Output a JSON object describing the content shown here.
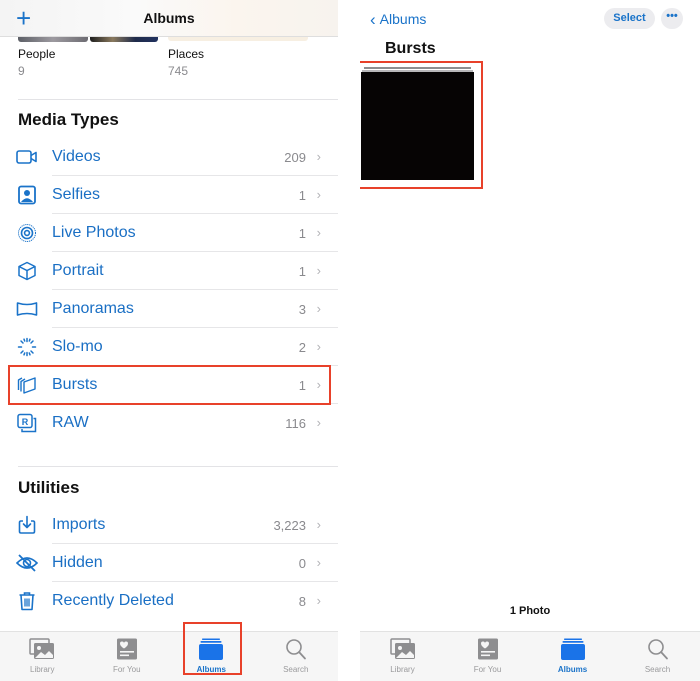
{
  "left": {
    "nav": {
      "title": "Albums",
      "add_icon": "plus-icon"
    },
    "people": {
      "name": "People",
      "count": "9"
    },
    "places": {
      "name": "Places",
      "count": "745"
    },
    "media_types": {
      "title": "Media Types",
      "items": [
        {
          "label": "Videos",
          "count": "209",
          "icon": "video-icon"
        },
        {
          "label": "Selfies",
          "count": "1",
          "icon": "selfie-icon"
        },
        {
          "label": "Live Photos",
          "count": "1",
          "icon": "live-photo-icon"
        },
        {
          "label": "Portrait",
          "count": "1",
          "icon": "cube-icon"
        },
        {
          "label": "Panoramas",
          "count": "3",
          "icon": "panorama-icon"
        },
        {
          "label": "Slo-mo",
          "count": "2",
          "icon": "slomo-icon"
        },
        {
          "label": "Bursts",
          "count": "1",
          "icon": "bursts-icon",
          "highlighted": true
        },
        {
          "label": "RAW",
          "count": "116",
          "icon": "raw-icon"
        }
      ]
    },
    "utilities": {
      "title": "Utilities",
      "items": [
        {
          "label": "Imports",
          "count": "3,223",
          "icon": "import-icon"
        },
        {
          "label": "Hidden",
          "count": "0",
          "icon": "eye-slash-icon"
        },
        {
          "label": "Recently Deleted",
          "count": "8",
          "icon": "trash-icon"
        }
      ]
    },
    "tabbar": {
      "active": "Albums",
      "tabs": [
        {
          "label": "Library",
          "icon": "library-icon"
        },
        {
          "label": "For You",
          "icon": "for-you-icon"
        },
        {
          "label": "Albums",
          "icon": "albums-icon"
        },
        {
          "label": "Search",
          "icon": "search-icon"
        }
      ]
    }
  },
  "right": {
    "nav": {
      "back_label": "Albums",
      "select_label": "Select",
      "more_label": "•••"
    },
    "album_title": "Bursts",
    "photo_count": "1 Photo",
    "tabbar": {
      "active": "Albums",
      "tabs": [
        {
          "label": "Library",
          "icon": "library-icon"
        },
        {
          "label": "For You",
          "icon": "for-you-icon"
        },
        {
          "label": "Albums",
          "icon": "albums-icon"
        },
        {
          "label": "Search",
          "icon": "search-icon"
        }
      ]
    }
  },
  "colors": {
    "accent": "#1a73c9",
    "highlight": "#e8412a",
    "secondary_text": "#8a8a8e"
  }
}
